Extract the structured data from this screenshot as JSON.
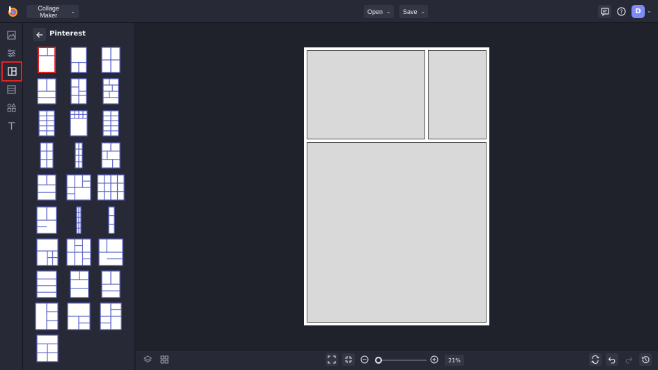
{
  "topbar": {
    "app_name": "Collage Maker",
    "open_label": "Open",
    "save_label": "Save",
    "avatar_initial": "D"
  },
  "panel": {
    "title": "Pinterest"
  },
  "zoom": {
    "value_label": "21%",
    "level_percent": 21
  },
  "colors": {
    "accent": "#7e8bf5",
    "selected_outline": "#e02424",
    "thumb_outline": "#5b63c9"
  },
  "icons": {
    "rail": [
      "image-icon",
      "adjust-icon",
      "layout-icon",
      "texture-icon",
      "shapes-icon",
      "text-icon"
    ]
  }
}
